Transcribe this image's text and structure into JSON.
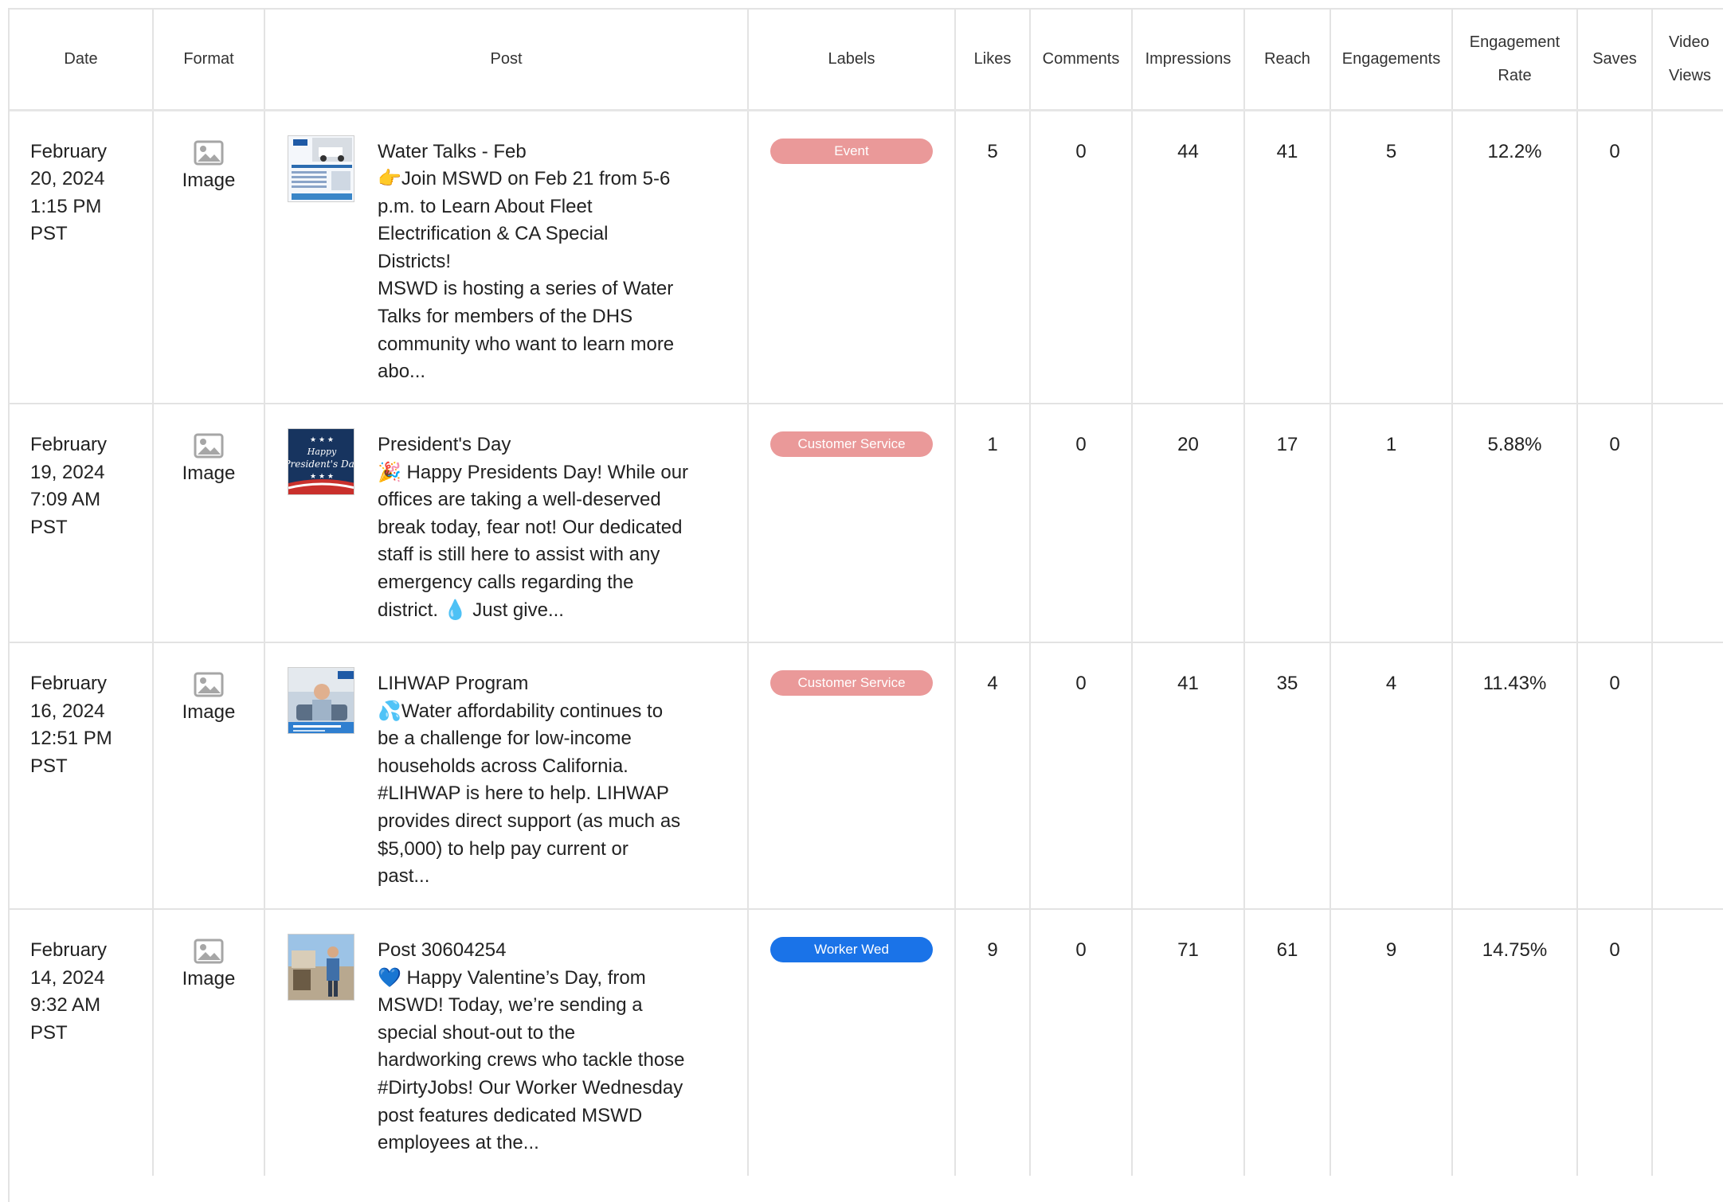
{
  "columns": {
    "date": "Date",
    "format": "Format",
    "post": "Post",
    "labels": "Labels",
    "likes": "Likes",
    "comments": "Comments",
    "impressions": "Impressions",
    "reach": "Reach",
    "engagements": "Engagements",
    "engagement_rate_l1": "Engagement",
    "engagement_rate_l2": "Rate",
    "saves": "Saves",
    "video_views_l1": "Video",
    "video_views_l2": "Views"
  },
  "rows": [
    {
      "date_l1": "February",
      "date_l2": "20, 2024",
      "date_l3": "1:15 PM",
      "date_l4": "PST",
      "format": "Image",
      "format_icon": "image-icon",
      "post_title": "Water Talks - Feb",
      "post_lines": [
        "👉Join MSWD on Feb 21 from 5-6",
        "p.m. to Learn About Fleet",
        "Electrification & CA Special",
        "Districts!",
        "MSWD is hosting a series of Water",
        "Talks for members of the DHS",
        "community who want to learn more",
        "abo..."
      ],
      "label": "Event",
      "label_color": "#ea9999",
      "likes": "5",
      "comments": "0",
      "impressions": "44",
      "reach": "41",
      "engagements": "5",
      "engagement_rate": "12.2%",
      "saves": "0"
    },
    {
      "date_l1": "February",
      "date_l2": "19, 2024",
      "date_l3": "7:09 AM",
      "date_l4": "PST",
      "format": "Image",
      "format_icon": "image-icon",
      "post_title": "President's Day",
      "post_lines": [
        "🎉 Happy Presidents Day! While our",
        "offices are taking a well-deserved",
        "break today, fear not! Our dedicated",
        "staff is still here to assist with any",
        "emergency calls regarding the",
        "district. 💧 Just give..."
      ],
      "label": "Customer Service",
      "label_color": "#ea9999",
      "likes": "1",
      "comments": "0",
      "impressions": "20",
      "reach": "17",
      "engagements": "1",
      "engagement_rate": "5.88%",
      "saves": "0"
    },
    {
      "date_l1": "February",
      "date_l2": "16, 2024",
      "date_l3": "12:51 PM",
      "date_l4": "PST",
      "format": "Image",
      "format_icon": "image-icon",
      "post_title": "LIHWAP Program",
      "post_lines": [
        "💦Water affordability continues to",
        "be a challenge for low-income",
        "households across California.",
        "#LIHWAP is here to help. LIHWAP",
        "provides direct support (as much as",
        "$5,000) to help pay current or",
        "past..."
      ],
      "label": "Customer Service",
      "label_color": "#ea9999",
      "likes": "4",
      "comments": "0",
      "impressions": "41",
      "reach": "35",
      "engagements": "4",
      "engagement_rate": "11.43%",
      "saves": "0"
    },
    {
      "date_l1": "February",
      "date_l2": "14, 2024",
      "date_l3": "9:32 AM",
      "date_l4": "PST",
      "format": "Image",
      "format_icon": "image-icon",
      "post_title": "Post 30604254",
      "post_lines": [
        "💙 Happy Valentine’s Day, from",
        "MSWD! Today, we’re sending a",
        "special shout-out to the",
        "hardworking crews who tackle those",
        "#DirtyJobs! Our Worker Wednesday",
        "post features dedicated MSWD",
        "employees at the..."
      ],
      "label": "Worker Wed",
      "label_color": "#1a73e8",
      "likes": "9",
      "comments": "0",
      "impressions": "71",
      "reach": "61",
      "engagements": "9",
      "engagement_rate": "14.75%",
      "saves": "0"
    }
  ]
}
